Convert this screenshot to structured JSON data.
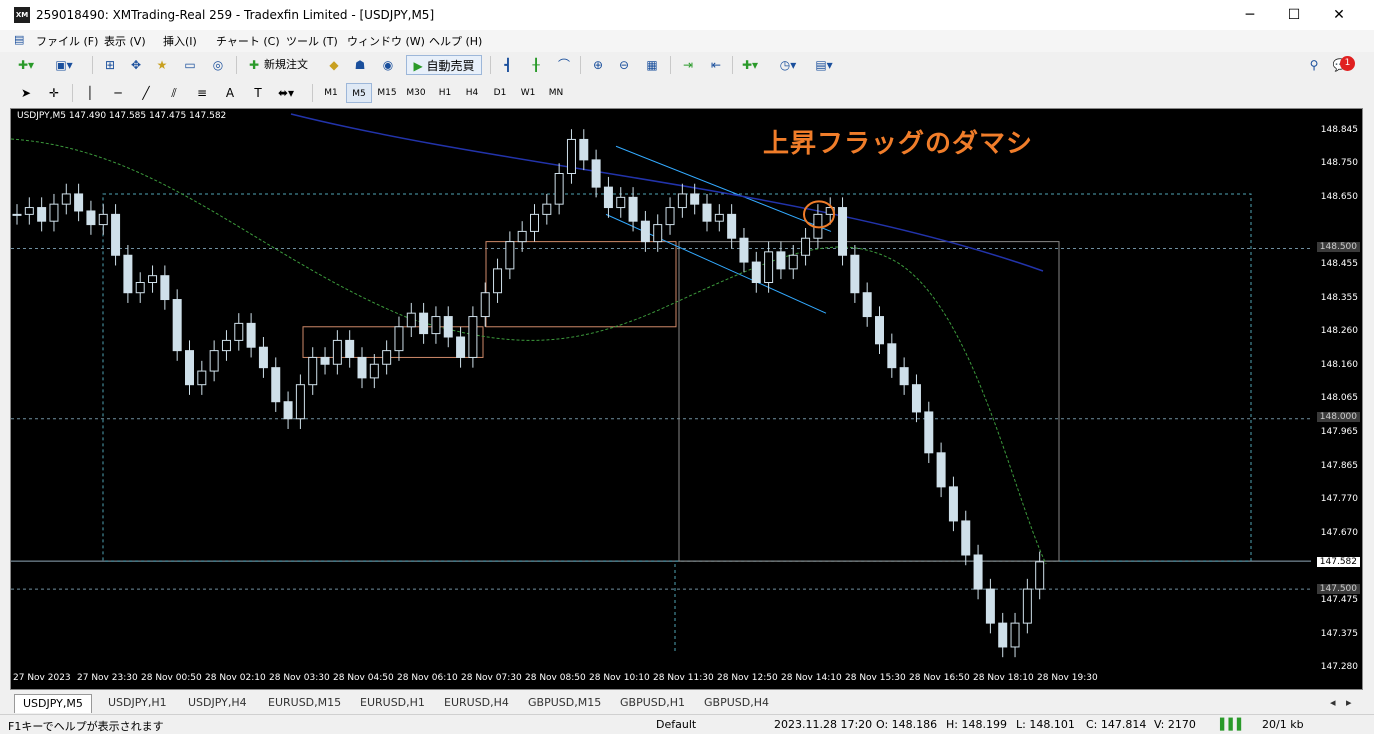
{
  "window": {
    "title": "259018490: XMTrading-Real 259 - Tradexfin Limited - [USDJPY,M5]",
    "app_icon": "XM",
    "minimize": "─",
    "maximize": "☐",
    "close": "✕"
  },
  "menu": [
    {
      "label": "ファイル (F)"
    },
    {
      "label": "表示 (V)"
    },
    {
      "label": "挿入(I)"
    },
    {
      "label": "チャート (C)"
    },
    {
      "label": "ツール (T)"
    },
    {
      "label": "ウィンドウ (W)"
    },
    {
      "label": "ヘルプ (H)"
    }
  ],
  "toolbar": {
    "new_order": "新規注文",
    "auto_trade": "自動売買",
    "notification_count": "1"
  },
  "timeframes": [
    "M1",
    "M5",
    "M15",
    "M30",
    "H1",
    "H4",
    "D1",
    "W1",
    "MN"
  ],
  "active_timeframe": "M5",
  "chart": {
    "info": "USDJPY,M5  147.490 147.585 147.475 147.582",
    "annotation": "上昇フラッグのダマシ",
    "annotation_color": "#f07d2a",
    "price_labels": [
      "148.845",
      "148.750",
      "148.650",
      "148.455",
      "148.355",
      "148.260",
      "148.160",
      "148.065",
      "147.965",
      "147.865",
      "147.770",
      "147.670",
      "147.475",
      "147.375",
      "147.280"
    ],
    "price_boxes": {
      "p148500": "148.500",
      "p148000": "148.000",
      "current": "147.582",
      "p147500": "147.500"
    },
    "time_labels": [
      "27 Nov 2023",
      "27 Nov 23:30",
      "28 Nov 00:50",
      "28 Nov 02:10",
      "28 Nov 03:30",
      "28 Nov 04:50",
      "28 Nov 06:10",
      "28 Nov 07:30",
      "28 Nov 08:50",
      "28 Nov 10:10",
      "28 Nov 11:30",
      "28 Nov 12:50",
      "28 Nov 14:10",
      "28 Nov 15:30",
      "28 Nov 16:50",
      "28 Nov 18:10",
      "28 Nov 19:30"
    ]
  },
  "chart_data": {
    "type": "candlestick",
    "symbol": "USDJPY",
    "timeframe": "M5",
    "ylim": [
      147.28,
      148.88
    ],
    "series": [
      {
        "values": [
          148.6,
          148.62,
          148.58,
          148.63,
          148.66,
          148.61,
          148.57,
          148.6,
          148.48,
          148.37,
          148.4,
          148.42,
          148.35,
          148.2,
          148.1,
          148.14,
          148.2,
          148.23,
          148.28,
          148.21,
          148.15,
          148.05,
          148.0,
          148.1,
          148.18,
          148.16,
          148.23,
          148.18,
          148.12,
          148.16,
          148.2,
          148.27,
          148.31,
          148.25,
          148.3,
          148.24,
          148.18,
          148.3,
          148.37,
          148.44,
          148.52,
          148.55,
          148.6,
          148.63,
          148.72,
          148.82,
          148.76,
          148.68,
          148.62,
          148.65,
          148.58,
          148.52,
          148.57,
          148.62,
          148.66,
          148.63,
          148.58,
          148.6,
          148.53,
          148.46,
          148.4,
          148.49,
          148.44,
          148.48,
          148.53,
          148.6,
          148.62,
          148.48,
          148.37,
          148.3,
          148.22,
          148.15,
          148.1,
          148.02,
          147.9,
          147.8,
          147.7,
          147.6,
          147.5,
          147.4,
          147.33,
          147.4,
          147.5,
          147.58
        ]
      }
    ],
    "moving_averages": [
      {
        "name": "blue",
        "color": "#2233aa"
      },
      {
        "name": "green",
        "color": "#3c9a3c"
      }
    ],
    "horizontal_levels": [
      148.5,
      148.0,
      147.582,
      147.5
    ]
  }
}
